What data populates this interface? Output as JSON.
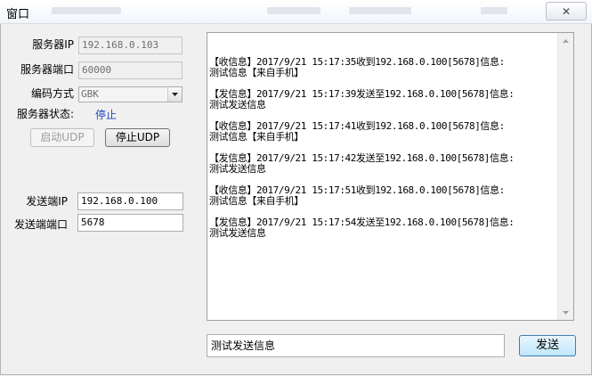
{
  "window": {
    "title": "窗口",
    "close_label": "✕"
  },
  "left": {
    "server_ip_label": "服务器IP",
    "server_ip_value": "192.168.0.103",
    "server_port_label": "服务器端口",
    "server_port_value": "60000",
    "encoding_label": "编码方式",
    "encoding_value": "GBK",
    "status_label": "服务器状态:",
    "status_value": "停止",
    "start_udp_label": "启动UDP",
    "stop_udp_label": "停止UDP",
    "send_ip_label": "发送端IP",
    "send_ip_value": "192.168.0.100",
    "send_port_label": "发送端端口",
    "send_port_value": "5678"
  },
  "log": {
    "messages": [
      "【收信息】2017/9/21 15:17:35收到192.168.0.100[5678]信息:\n测试信息【来自手机】",
      "【发信息】2017/9/21 15:17:39发送至192.168.0.100[5678]信息:\n测试发送信息",
      "【收信息】2017/9/21 15:17:41收到192.168.0.100[5678]信息:\n测试信息【来自手机】",
      "【发信息】2017/9/21 15:17:42发送至192.168.0.100[5678]信息:\n测试发送信息",
      "【收信息】2017/9/21 15:17:51收到192.168.0.100[5678]信息:\n测试信息【来自手机】",
      "【发信息】2017/9/21 15:17:54发送至192.168.0.100[5678]信息:\n测试发送信息"
    ]
  },
  "send": {
    "input_value": "测试发送信息",
    "button_label": "发送"
  },
  "colors": {
    "status_text": "#1f3fbf",
    "send_button_border": "#3c7fb1"
  }
}
